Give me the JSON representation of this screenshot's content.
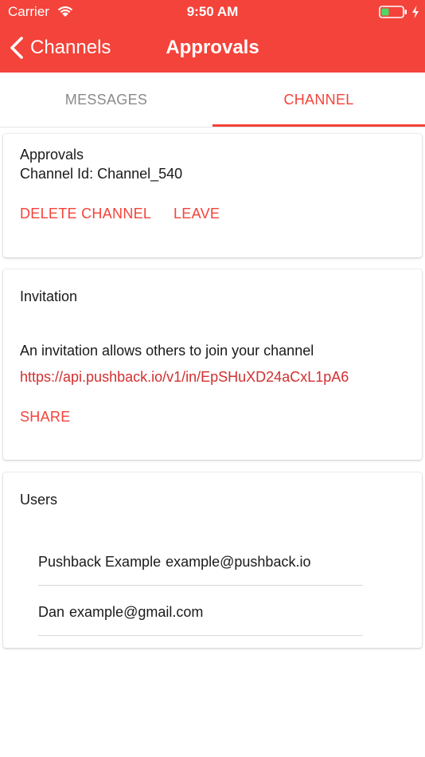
{
  "status_bar": {
    "carrier": "Carrier",
    "time": "9:50 AM"
  },
  "nav": {
    "back_label": "Channels",
    "title": "Approvals"
  },
  "tabs": [
    {
      "label": "MESSAGES",
      "active": false
    },
    {
      "label": "CHANNEL",
      "active": true
    }
  ],
  "channel": {
    "name": "Approvals",
    "id_line": "Channel Id: Channel_540",
    "delete_label": "DELETE CHANNEL",
    "leave_label": "LEAVE"
  },
  "invitation": {
    "heading": "Invitation",
    "description": "An invitation allows others to join your channel",
    "url": "https://api.pushback.io/v1/in/EpSHuXD24aCxL1pA6",
    "share_label": "SHARE"
  },
  "users": {
    "heading": "Users",
    "items": [
      {
        "name": "Pushback Example",
        "email": "example@pushback.io"
      },
      {
        "name": "Dan",
        "email": "example@gmail.com"
      }
    ]
  },
  "colors": {
    "brand": "#f4433a",
    "link": "#d32f2f",
    "battery_fill": "#4cd964"
  }
}
